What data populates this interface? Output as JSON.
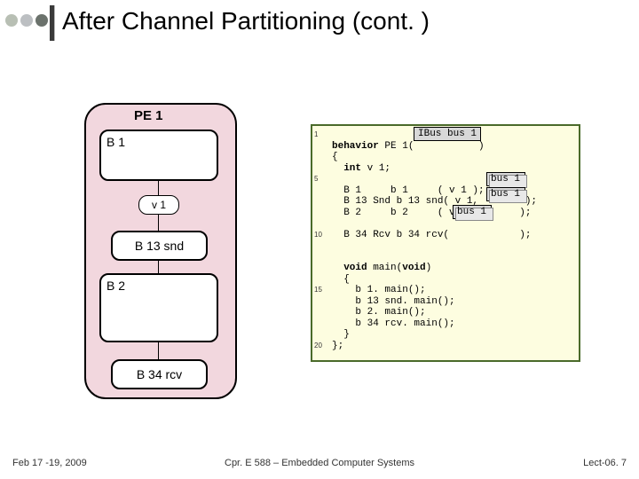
{
  "slide": {
    "title": "After Channel Partitioning (cont. )"
  },
  "diagram": {
    "pe_label": "PE 1",
    "b1": "B 1",
    "v1": "v 1",
    "b13snd": "B 13 snd",
    "b2": "B 2",
    "b34rcv": "B 34 rcv"
  },
  "code": {
    "line_nums": {
      "n1": "1",
      "n5": "5",
      "n10": "10",
      "n15": "15",
      "n20": "20"
    },
    "l1a": "behavior",
    "l1b": " PE 1(",
    "l1c": "           )",
    "chip_ibus": "IBus bus 1",
    "l2": "{",
    "l3a": "  int",
    "l3b": " v 1;",
    "blank": "",
    "l5": "  B 1     b 1     ( v 1 );",
    "l6": "  B 13 Snd b 13 snd( v 1,        );",
    "chip_bus1a": "bus 1",
    "l7": "  B 2     b 2     ( v 1,        );",
    "chip_bus1b": "bus 1",
    "l9": "  B 34 Rcv b 34 rcv(            );",
    "chip_bus1c": "bus 1",
    "l11a": "  void",
    "l11b": " main(",
    "l11c": "void",
    "l11d": ")",
    "l12": "  {",
    "l13": "    b 1. main();",
    "l14": "    b 13 snd. main();",
    "l15": "    b 2. main();",
    "l16": "    b 34 rcv. main();",
    "l17": "  }",
    "l18": "};"
  },
  "footer": {
    "left": "Feb 17 -19, 2009",
    "mid": "Cpr. E 588 – Embedded Computer Systems",
    "right": "Lect-06. 7"
  }
}
